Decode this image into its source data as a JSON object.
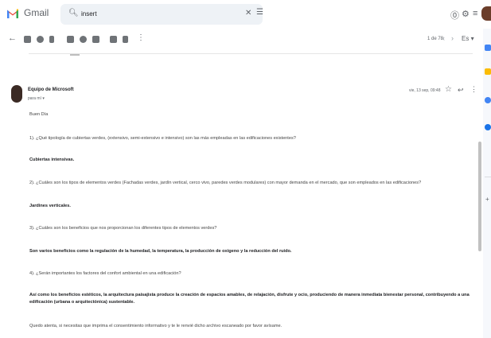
{
  "app": {
    "name": "Gmail"
  },
  "search": {
    "query": "insert"
  },
  "header": {
    "help_icon": "help-icon",
    "settings_icon": "gear-icon",
    "apps_icon": "apps-grid-icon"
  },
  "toolbar": {
    "pagination": "1 de 78",
    "language": "Es",
    "icons": [
      "back-arrow-icon",
      "archive-icon",
      "report-spam-icon",
      "delete-icon",
      "mark-unread-icon",
      "snooze-icon",
      "add-to-tasks-icon",
      "move-to-icon",
      "label-icon",
      "more-icon"
    ]
  },
  "message": {
    "sender": "Equipo de Microsoft",
    "recipient": "para mí",
    "date": "vie, 13 sep, 09:48",
    "greeting": "Buen Día",
    "paragraphs": [
      {
        "text": "1). ¿Qué tipología de cubiertas verdes, (extensivo, semi-extensivo e intensivo) son las más empleadas en las edificaciones existentes?",
        "bold": false
      },
      {
        "text": "Cubiertas intensivas.",
        "bold": true
      },
      {
        "text": "2). ¿Cuáles son los tipos de elementos verdes (Fachadas verdes, jardín vertical, cerco vivo, paredes verdes modulares) con mayor demanda en el mercado, que son empleados en las edificaciones?",
        "bold": false
      },
      {
        "text": "Jardines verticales.",
        "bold": true
      },
      {
        "text": "3). ¿Cuáles son los beneficios que nos proporcionan los diferentes tipos de elementos verdes?",
        "bold": false
      },
      {
        "text": "Son varios beneficios como la regulación de la humedad, la temperatura, la producción de oxigeno y la reducción del ruido.",
        "bold": true
      },
      {
        "text": "4). ¿Serán importantes los factores del confort ambiental en una edificación?",
        "bold": false
      },
      {
        "text": "Así como los beneficios estéticos, la arquitectura paisajista produce la creación de espacios amables, de relajación, disfrute y ocio, produciendo de manera inmediata bienestar personal, contribuyendo a una edificación (urbana o arquitectónica) sustentable.",
        "bold": true
      },
      {
        "text": "Quedo atenta, si necesitas que imprima el consentimiento informativo y te le renvié dicho archivo escaneado por favor avísame.",
        "bold": false
      }
    ]
  },
  "colors": {
    "gmail_red": "#ea4335",
    "search_bg": "#eef2f6",
    "text": "#202124",
    "muted": "#5f6368"
  }
}
